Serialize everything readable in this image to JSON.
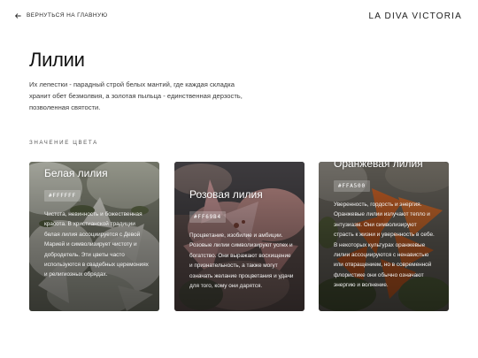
{
  "header": {
    "back_label": "ВЕРНУТЬСЯ НА ГЛАВНУЮ",
    "brand": "LA DIVA VICTORIA"
  },
  "main": {
    "title": "Лилии",
    "intro": "Их лепестки - парадный строй белых мантий, где каждая складка хранит обет безмолвия, а золотая пыльца - единственная дерзость, позволенная святости.",
    "section_label": "ЗНАЧЕНИЕ ЦВЕТА"
  },
  "cards": [
    {
      "title": "Белая лилия",
      "hex": "#FFFFFF",
      "description": "Чистота, невинность и божественная красота. В христианской традиции белая лилия ассоциируется с Девой Марией и символизирует чистоту и добродетель. Эти цветы часто используются в свадебных церемониях и религиозных обрядах.",
      "color": "#FFFFFF"
    },
    {
      "title": "Розовая лилия",
      "hex": "#FF69B4",
      "description": "Процветание, изобилие и амбиции. Розовые лилии символизируют успех и богатство. Они выражают восхищение и признательность, а также могут означать желание процветания и удачи для того, кому они дарятся.",
      "color": "#FF69B4"
    },
    {
      "title": "Оранжевая лилия",
      "hex": "#FFA500",
      "description": "Уверенность, гордость и энергия. Оранжевые лилии излучают тепло и энтузиазм. Они символизируют страсть к жизни и уверенность в себе. В некоторых культурах оранжевые лилии ассоциируются с ненавистью или отвращением, но в современной флористике они обычно означают энергию и волнение.",
      "color": "#FFA500"
    }
  ],
  "icons": {
    "back": "arrow-left-icon"
  }
}
